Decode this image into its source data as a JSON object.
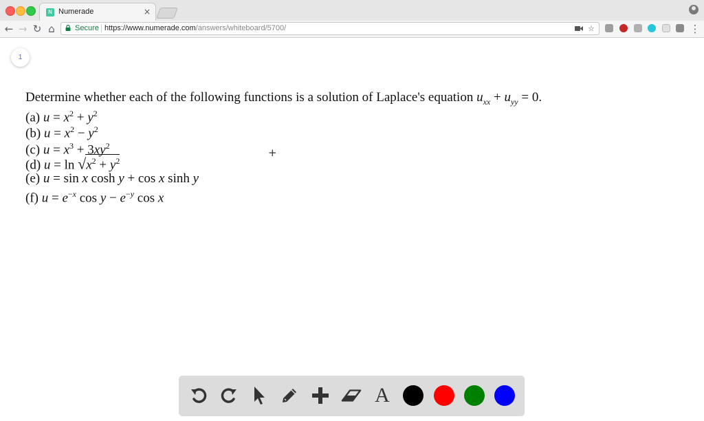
{
  "browser": {
    "tab_title": "Numerade",
    "tab_favicon_text": "N",
    "tab_close": "×",
    "secure_label": "Secure",
    "url_host": "https://www.numerade.com",
    "url_path": "/answers/whiteboard/5700/"
  },
  "page": {
    "page_number": "1",
    "question": {
      "intro": "Determine whether each of the following functions is a solution of Laplace's equation",
      "equation_tail": "= 0.",
      "items": [
        {
          "label": "(a)"
        },
        {
          "label": "(b)"
        },
        {
          "label": "(c)"
        },
        {
          "label": "(d)"
        },
        {
          "label": "(e)"
        },
        {
          "label": "(f)"
        }
      ]
    }
  },
  "tools": {
    "items": [
      "undo-icon",
      "redo-icon",
      "pointer-icon",
      "pencil-icon",
      "add-icon",
      "eraser-icon",
      "text-icon"
    ],
    "text_tool_glyph": "A",
    "colors": [
      "#000000",
      "#ff0000",
      "#008000",
      "#0000ff"
    ]
  }
}
